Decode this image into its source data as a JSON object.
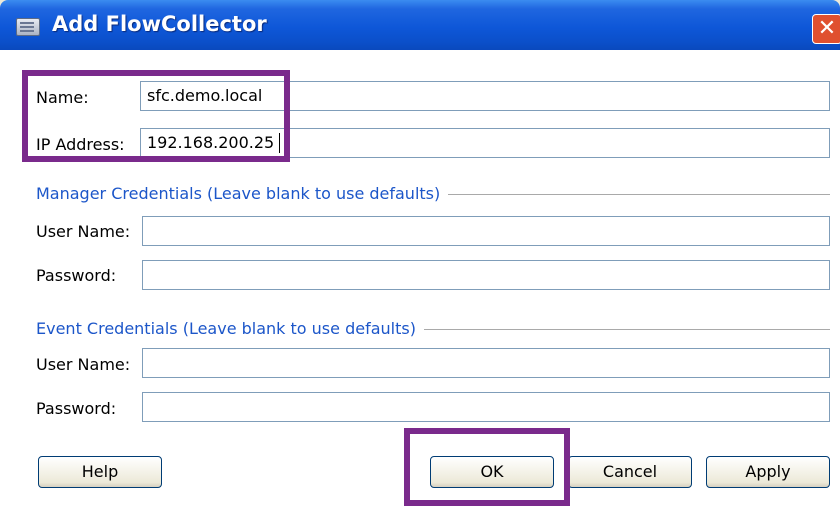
{
  "window": {
    "title": "Add FlowCollector",
    "close_symbol": "✕"
  },
  "form": {
    "name_label": "Name:",
    "name_value": "sfc.demo.local",
    "ip_label": "IP Address:",
    "ip_value": "192.168.200.25",
    "manager_group": "Manager Credentials (Leave blank to use defaults)",
    "manager_user_label": "User Name:",
    "manager_user_value": "",
    "manager_password_label": "Password:",
    "manager_password_value": "",
    "event_group": "Event Credentials (Leave blank to use defaults)",
    "event_user_label": "User Name:",
    "event_user_value": "",
    "event_password_label": "Password:",
    "event_password_value": ""
  },
  "buttons": {
    "help": "Help",
    "ok": "OK",
    "cancel": "Cancel",
    "apply": "Apply"
  },
  "colors": {
    "highlight": "#7a2a8c",
    "titlebar": "#0e57d8",
    "group_title": "#1c56c9"
  }
}
